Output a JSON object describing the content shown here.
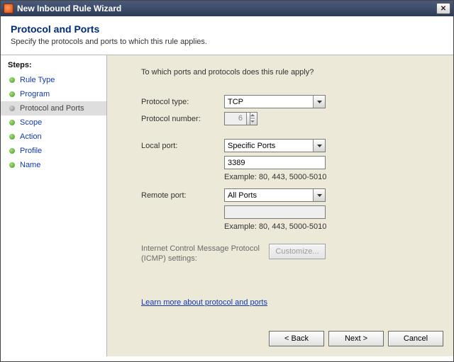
{
  "window": {
    "title": "New Inbound Rule Wizard",
    "close_glyph": "✕"
  },
  "header": {
    "title": "Protocol and Ports",
    "subtitle": "Specify the protocols and ports to which this rule applies."
  },
  "sidebar": {
    "title": "Steps:",
    "items": [
      {
        "label": "Rule Type"
      },
      {
        "label": "Program"
      },
      {
        "label": "Protocol and Ports"
      },
      {
        "label": "Scope"
      },
      {
        "label": "Action"
      },
      {
        "label": "Profile"
      },
      {
        "label": "Name"
      }
    ],
    "active_index": 2
  },
  "content": {
    "question": "To which ports and protocols does this rule apply?",
    "protocol_type_label": "Protocol type:",
    "protocol_type_value": "TCP",
    "protocol_number_label": "Protocol number:",
    "protocol_number_value": "6",
    "local_port_label": "Local port:",
    "local_port_select": "Specific Ports",
    "local_port_value": "3389",
    "example_text": "Example: 80, 443, 5000-5010",
    "remote_port_label": "Remote port:",
    "remote_port_select": "All Ports",
    "remote_port_value": "",
    "icmp_label": "Internet Control Message Protocol (ICMP) settings:",
    "customize_btn": "Customize...",
    "learn_link": "Learn more about protocol and ports"
  },
  "buttons": {
    "back": "< Back",
    "next": "Next >",
    "cancel": "Cancel"
  }
}
